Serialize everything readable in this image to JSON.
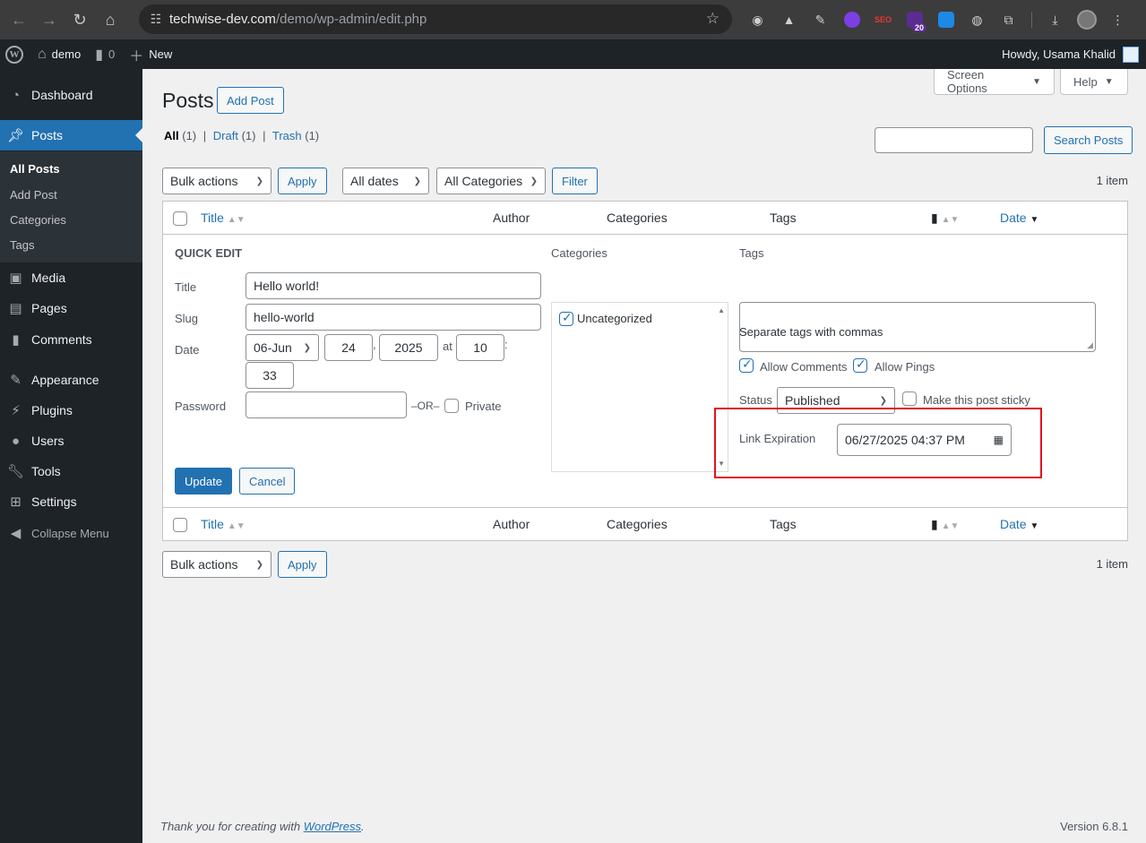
{
  "browser": {
    "url_host": "techwise-dev.com",
    "url_path": "/demo/wp-admin/edit.php",
    "extension_badge": "20",
    "seo_label": "SEO"
  },
  "adminbar": {
    "site_name": "demo",
    "comments_count": "0",
    "new_label": "New",
    "greeting": "Howdy, Usama Khalid"
  },
  "sidebar": {
    "items": [
      {
        "label": "Dashboard"
      },
      {
        "label": "Posts"
      },
      {
        "label": "Media"
      },
      {
        "label": "Pages"
      },
      {
        "label": "Comments"
      },
      {
        "label": "Appearance"
      },
      {
        "label": "Plugins"
      },
      {
        "label": "Users"
      },
      {
        "label": "Tools"
      },
      {
        "label": "Settings"
      },
      {
        "label": "Collapse Menu"
      }
    ],
    "submenu": [
      "All Posts",
      "Add Post",
      "Categories",
      "Tags"
    ]
  },
  "header": {
    "screen_options": "Screen Options",
    "help": "Help",
    "title": "Posts",
    "add_post": "Add Post"
  },
  "filters": {
    "all": "All",
    "all_count": "(1)",
    "draft": "Draft",
    "draft_count": "(1)",
    "trash": "Trash",
    "trash_count": "(1)",
    "sep": "|",
    "search_button": "Search Posts",
    "bulk_actions": "Bulk actions",
    "apply": "Apply",
    "all_dates": "All dates",
    "all_categories": "All Categories",
    "filter": "Filter",
    "items_count": "1 item"
  },
  "columns": {
    "title": "Title",
    "author": "Author",
    "categories": "Categories",
    "tags": "Tags",
    "date": "Date"
  },
  "quick_edit": {
    "heading": "QUICK EDIT",
    "title_label": "Title",
    "title_value": "Hello world!",
    "slug_label": "Slug",
    "slug_value": "hello-world",
    "date_label": "Date",
    "month": "06-Jun",
    "day": "24",
    "comma": ",",
    "year": "2025",
    "at": "at",
    "hour": "10",
    "colon": ":",
    "minute": "33",
    "password_label": "Password",
    "or": "–OR–",
    "private_label": "Private",
    "categories_label": "Categories",
    "category_item": "Uncategorized",
    "tags_label": "Tags",
    "tags_hint": "Separate tags with commas",
    "allow_comments": "Allow Comments",
    "allow_pings": "Allow Pings",
    "status_label": "Status",
    "status_value": "Published",
    "sticky_label": "Make this post sticky",
    "link_expiration_label": "Link Expiration",
    "link_expiration_value": "06/27/2025 04:37 PM",
    "update": "Update",
    "cancel": "Cancel"
  },
  "footer": {
    "thanks_prefix": "Thank you for creating with ",
    "thanks_link": "WordPress",
    "thanks_suffix": ".",
    "version": "Version 6.8.1"
  },
  "colors": {
    "accent": "#2271b1",
    "sidebar_bg": "#1d2327",
    "highlight": "#e0141e"
  }
}
